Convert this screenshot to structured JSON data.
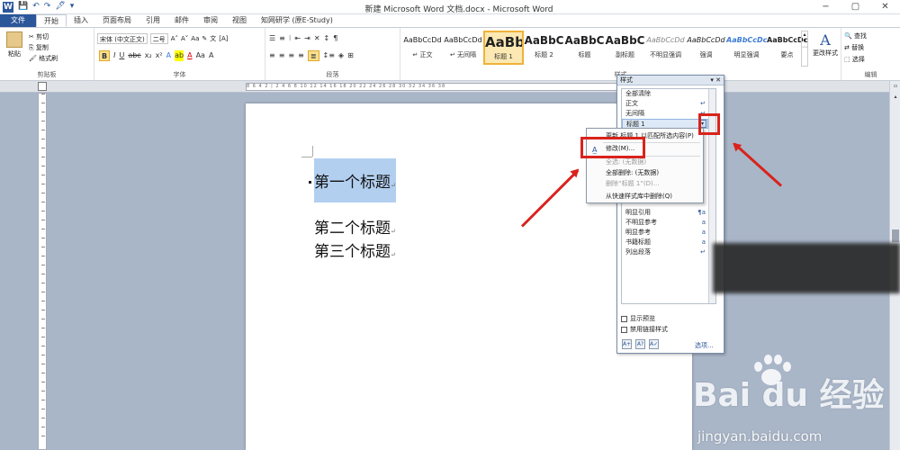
{
  "window": {
    "app_icon": "W",
    "title": "新建 Microsoft Word 文档.docx - Microsoft Word",
    "qat": [
      "💾",
      "↶",
      "↷",
      "🖋",
      "▾"
    ],
    "controls": [
      "−",
      "▢",
      "✕"
    ]
  },
  "tabs": [
    "文件",
    "开始",
    "插入",
    "页面布局",
    "引用",
    "邮件",
    "审阅",
    "视图",
    "知网研学 (原E-Study)"
  ],
  "ribbon": {
    "clipboard": {
      "paste": "粘贴",
      "cut": "剪切",
      "copy": "复制",
      "format_painter": "格式刷",
      "label": "剪贴板"
    },
    "font": {
      "font_name": "宋体 (中文正文)",
      "font_size": "二号",
      "label": "字体",
      "row2": [
        "B",
        "I",
        "U",
        "abc",
        "x₂",
        "x²",
        "A",
        "ab",
        "A",
        "Aa",
        "A"
      ]
    },
    "paragraph": {
      "label": "段落"
    },
    "styles": {
      "label": "样式",
      "items": [
        {
          "preview": "AaBbCcDd",
          "name": "↵ 正文"
        },
        {
          "preview": "AaBbCcDd",
          "name": "↵ 无间隔"
        },
        {
          "preview": "AaBb",
          "name": "标题 1"
        },
        {
          "preview": "AaBbC",
          "name": "标题 2"
        },
        {
          "preview": "AaBbC",
          "name": "标题"
        },
        {
          "preview": "AaBbC",
          "name": "副标题"
        },
        {
          "preview": "AaBbCcDd",
          "name": "不明显强调"
        },
        {
          "preview": "AaBbCcDd",
          "name": "强调"
        },
        {
          "preview": "AaBbCcDc",
          "name": "明显强调"
        },
        {
          "preview": "AaBbCcDc",
          "name": "要点"
        }
      ],
      "change_styles": "更改样式"
    },
    "editing": {
      "find": "查找",
      "replace": "替换",
      "select": "选择",
      "label": "编辑"
    }
  },
  "ruler_marks": "8 6 4 2 | 2 4 6 8 10 12 14 16 18 20 22 24 26 28 30 32 34 36 38",
  "document": {
    "heading1": "第一个标题",
    "heading2": "第二个标题",
    "heading3": "第三个标题",
    "para_mark": "↵"
  },
  "styles_pane": {
    "title": "样式",
    "close": "▾ ✕",
    "items": [
      {
        "label": "全部清除",
        "sym": ""
      },
      {
        "label": "正文",
        "sym": "↵"
      },
      {
        "label": "无间隔",
        "sym": "↵"
      },
      {
        "label": "标题 1",
        "sym": "▾"
      },
      {
        "label": "明显引用",
        "sym": "¶a"
      },
      {
        "label": "不明显参考",
        "sym": "a"
      },
      {
        "label": "明显参考",
        "sym": "a"
      },
      {
        "label": "书籍标题",
        "sym": "a"
      },
      {
        "label": "列出段落",
        "sym": "↵"
      }
    ],
    "show_preview": "显示预览",
    "disable_linked": "禁用链接样式",
    "options": "选项..."
  },
  "context_menu": {
    "update": "更新 标题 1 以匹配所选内容(P)",
    "modify": "修改(M)...",
    "select_all": "全选: (无数据)",
    "remove_all": "全部删除: (无数据)",
    "delete": "删除“标题 1”(D)...",
    "remove_gallery": "从快速样式库中删除(Q)"
  },
  "watermark": {
    "main": "Bai du 经验",
    "sub": "jingyan.baidu.com"
  },
  "colors": {
    "accent": "#2b579a",
    "highlight": "#d9231c",
    "selection": "#b2cff0"
  }
}
